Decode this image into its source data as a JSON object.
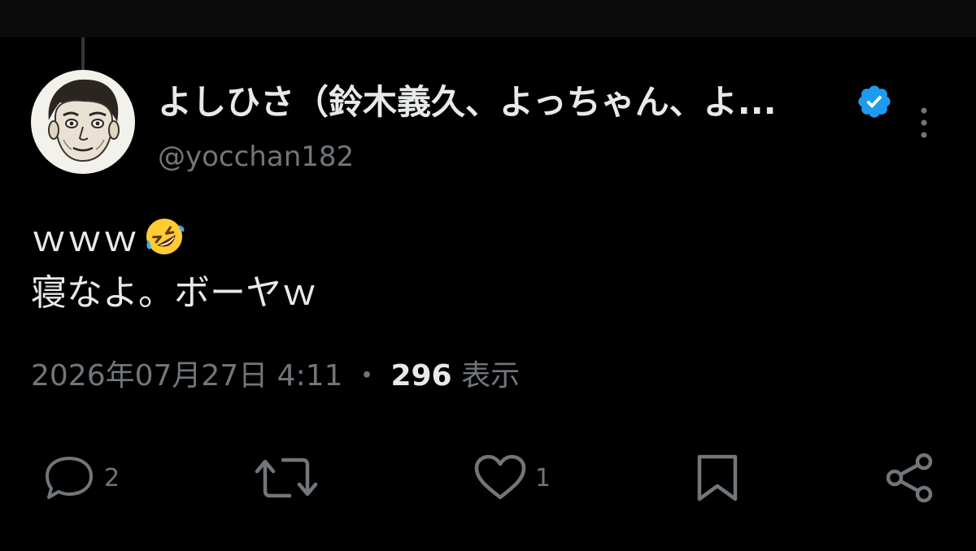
{
  "tweet": {
    "display_name": "よしひさ（鈴木義久、よっちゃん、よ...",
    "handle": "@yocchan182",
    "verified": true,
    "text_line1": "ｗｗｗ",
    "text_line1_emoji": "rolling-on-the-floor-laughing-emoji",
    "text_line2": "寝なよ。ボーヤｗ",
    "timestamp": "2026年07月27日 4:11",
    "separator": "・",
    "views_count": "296",
    "views_label": "表示"
  },
  "actions": {
    "reply_count": "2",
    "retweet_count": "",
    "like_count": "1"
  },
  "icons": {
    "verified": "verified-badge-icon",
    "more": "more-vertical-icon",
    "reply": "reply-icon",
    "retweet": "retweet-icon",
    "like": "heart-icon",
    "bookmark": "bookmark-icon",
    "share": "share-icon"
  },
  "colors": {
    "background": "#000000",
    "primary_text": "#e7e9ea",
    "secondary_text": "#71767b",
    "verified_blue": "#1d9bf0"
  }
}
